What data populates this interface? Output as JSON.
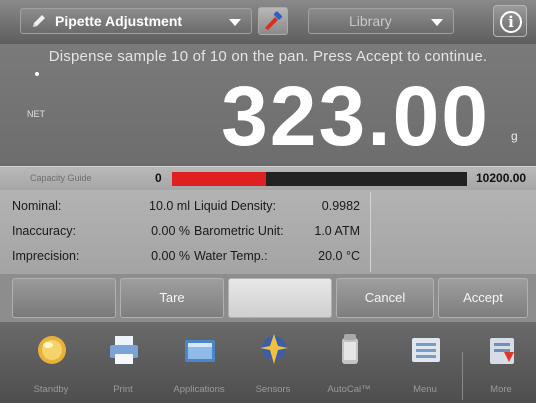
{
  "header": {
    "app_dropdown_label": "Pipette Adjustment",
    "library_dropdown_label": "Library",
    "info_icon_text": "i"
  },
  "weighing": {
    "prompt": "Dispense sample 10 of 10 on the pan.  Press Accept to continue.",
    "net_label": "NET",
    "value": "323.00",
    "unit": "g"
  },
  "capacity": {
    "label": "Capacity Guide",
    "min": "0",
    "max": "10200.00",
    "fill_fraction": 0.32,
    "fill_color": "#e02020"
  },
  "info": {
    "col1": [
      "Nominal:",
      "Inaccuracy:",
      "Imprecision:"
    ],
    "col2": [
      "10.0 ml",
      "0.00 %",
      "0.00 %"
    ],
    "col3": [
      "Liquid Density:",
      "Barometric Unit:",
      "Water Temp.:"
    ],
    "col4": [
      "0.9982",
      "1.0 ATM",
      "20.0 °C"
    ]
  },
  "actions": {
    "tare": "Tare",
    "cancel": "Cancel",
    "accept": "Accept"
  },
  "nav": [
    {
      "label": "Standby",
      "icon": "standby-icon"
    },
    {
      "label": "Print",
      "icon": "printer-icon"
    },
    {
      "label": "Applications",
      "icon": "applications-icon"
    },
    {
      "label": "Sensors",
      "icon": "sensors-icon"
    },
    {
      "label": "AutoCal™",
      "icon": "autocal-icon"
    },
    {
      "label": "Menu",
      "icon": "menu-icon"
    },
    {
      "label": "More",
      "icon": "more-icon"
    }
  ]
}
